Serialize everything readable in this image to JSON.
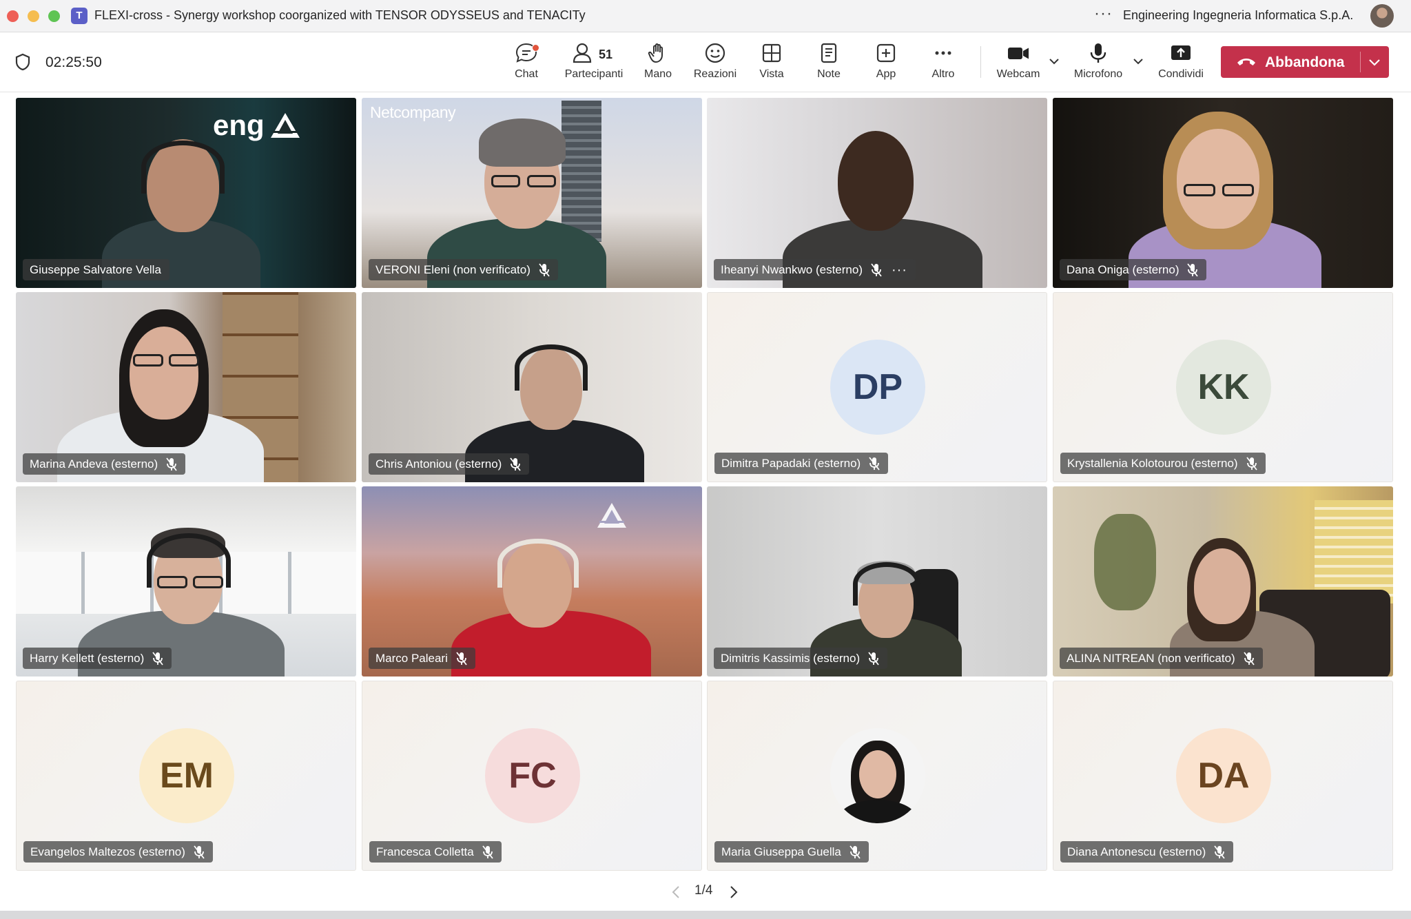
{
  "window": {
    "title": "FLEXI-cross - Synergy workshop coorganized with TENSOR ODYSSEUS and TENACITy",
    "more": "···",
    "organization": "Engineering Ingegneria Informatica S.p.A.",
    "app_icon_letter": "T",
    "accent": "#5b5fc7"
  },
  "toolbar": {
    "timer": "02:25:50",
    "chat": "Chat",
    "participants": "Partecipanti",
    "participants_count": "51",
    "raise_hand": "Mano",
    "reactions": "Reazioni",
    "view": "Vista",
    "notes": "Note",
    "apps": "App",
    "more": "Altro",
    "webcam": "Webcam",
    "microphone": "Microfono",
    "share": "Condividi",
    "leave": "Abbandona",
    "leave_color": "#c4314b"
  },
  "tiles": [
    {
      "name": "Giuseppe Salvatore Vella",
      "type": "video",
      "logo": "eng"
    },
    {
      "name": "VERONI Eleni (non verificato)",
      "type": "video",
      "logo": "Netcompany"
    },
    {
      "name": "Iheanyi Nwankwo (esterno)",
      "type": "video"
    },
    {
      "name": "Dana Oniga (esterno)",
      "type": "video"
    },
    {
      "name": "Marina Andeva (esterno)",
      "type": "video"
    },
    {
      "name": "Chris Antoniou (esterno)",
      "type": "video"
    },
    {
      "name": "Dimitra Papadaki (esterno)",
      "type": "avatar",
      "initials": "DP",
      "bg": "#dbe6f5",
      "fg": "#2b3e63"
    },
    {
      "name": "Krystallenia Kolotourou (esterno)",
      "type": "avatar",
      "initials": "KK",
      "bg": "#e3e8df",
      "fg": "#3b4a3a"
    },
    {
      "name": "Harry Kellett (esterno)",
      "type": "video"
    },
    {
      "name": "Marco Paleari",
      "type": "video"
    },
    {
      "name": "Dimitris Kassimis (esterno)",
      "type": "video"
    },
    {
      "name": "ALINA NITREAN (non verificato)",
      "type": "video"
    },
    {
      "name": "Evangelos Maltezos (esterno)",
      "type": "avatar",
      "initials": "EM",
      "bg": "#fbeccb",
      "fg": "#6a4a1c"
    },
    {
      "name": "Francesca Colletta",
      "type": "avatar",
      "initials": "FC",
      "bg": "#f6dcdc",
      "fg": "#6d3235"
    },
    {
      "name": "Maria Giuseppa Guella",
      "type": "photo"
    },
    {
      "name": "Diana Antonescu (esterno)",
      "type": "avatar",
      "initials": "DA",
      "bg": "#fbe3cf",
      "fg": "#6a4420"
    }
  ],
  "pager": {
    "label": "1/4"
  }
}
